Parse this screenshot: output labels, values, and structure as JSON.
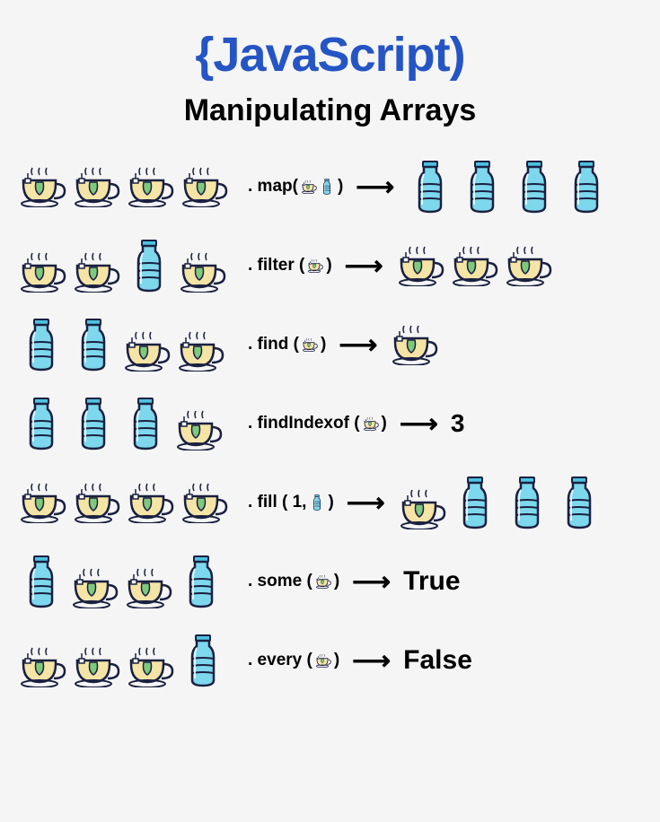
{
  "title": "{JavaScript)",
  "subtitle": "Manipulating Arrays",
  "rows": [
    {
      "input": [
        "tea",
        "tea",
        "tea",
        "tea"
      ],
      "method": ". map(",
      "params": [
        "tea",
        "bottle"
      ],
      "close": ")",
      "arrow": "⟶",
      "output_icons": [
        "bottle",
        "bottle",
        "bottle",
        "bottle"
      ],
      "output_text": ""
    },
    {
      "input": [
        "tea",
        "tea",
        "bottle",
        "tea"
      ],
      "method": ". filter (",
      "params": [
        "tea"
      ],
      "close": ")",
      "arrow": "⟶",
      "output_icons": [
        "tea",
        "tea",
        "tea"
      ],
      "output_text": ""
    },
    {
      "input": [
        "bottle",
        "bottle",
        "tea",
        "tea"
      ],
      "method": ". find (",
      "params": [
        "tea"
      ],
      "close": ")",
      "arrow": "⟶",
      "output_icons": [
        "tea"
      ],
      "output_text": ""
    },
    {
      "input": [
        "bottle",
        "bottle",
        "bottle",
        "tea"
      ],
      "method": ". findIndexof (",
      "params": [
        "tea"
      ],
      "close": ")",
      "arrow": "⟶",
      "output_icons": [],
      "output_text": "3"
    },
    {
      "input": [
        "tea",
        "tea",
        "tea",
        "tea"
      ],
      "method": ". fill ( 1,",
      "params": [
        "bottle"
      ],
      "close": ")",
      "arrow": "⟶",
      "output_icons": [
        "tea",
        "bottle",
        "bottle",
        "bottle"
      ],
      "output_text": ""
    },
    {
      "input": [
        "bottle",
        "tea",
        "tea",
        "bottle"
      ],
      "method": ". some (",
      "params": [
        "tea"
      ],
      "close": ")",
      "arrow": "⟶",
      "output_icons": [],
      "output_text": "True"
    },
    {
      "input": [
        "tea",
        "tea",
        "tea",
        "bottle"
      ],
      "method": ". every (",
      "params": [
        "tea"
      ],
      "close": ")",
      "arrow": "⟶",
      "output_icons": [],
      "output_text": "False"
    }
  ]
}
